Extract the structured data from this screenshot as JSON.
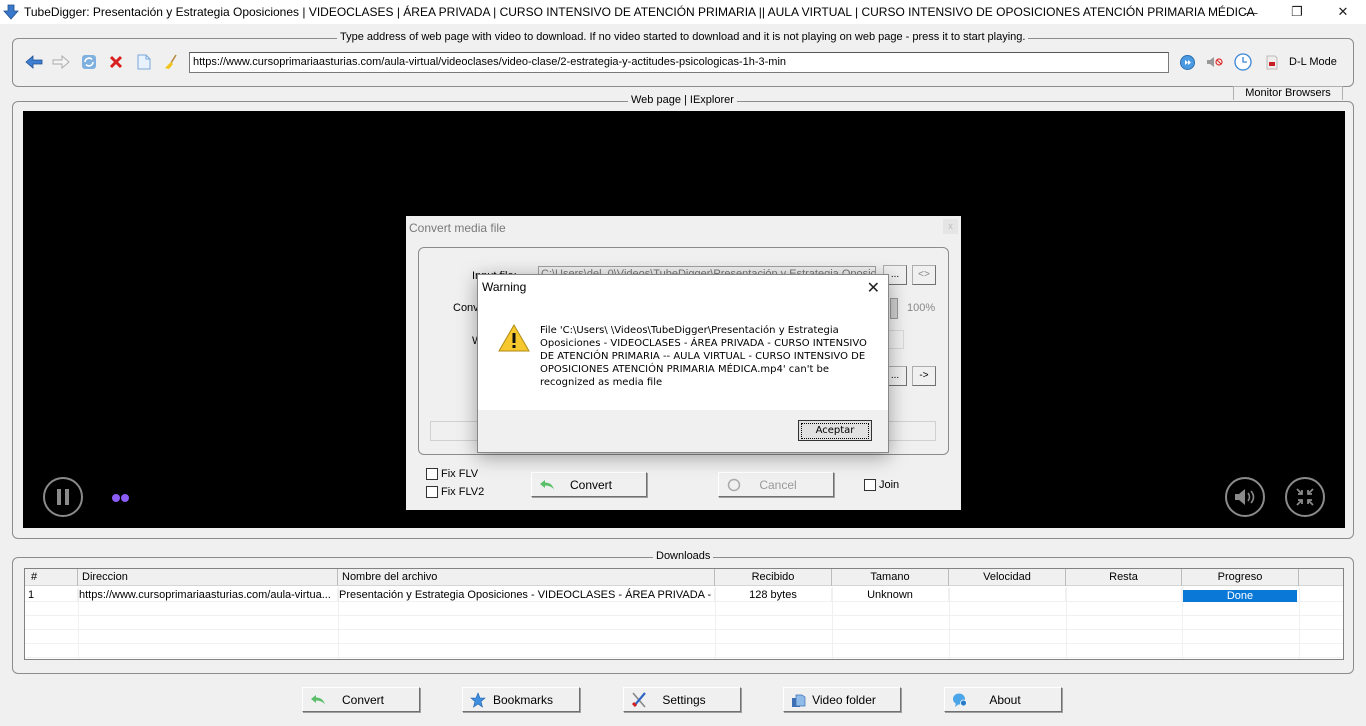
{
  "window": {
    "title": "TubeDigger: Presentación y Estrategia Oposiciones | VIDEOCLASES | ÁREA PRIVADA | CURSO INTENSIVO DE ATENCIÓN PRIMARIA || AULA VIRTUAL | CURSO INTENSIVO DE OPOSICIONES ATENCIÓN PRIMARIA MÉDICA",
    "minimize": "—",
    "maximize": "❐",
    "close": "✕"
  },
  "address_bar": {
    "legend": "Type address of web page with video to download. If no video started to download and it is not playing on web page - press it to start playing.",
    "url": "https://www.cursoprimariaasturias.com/aula-virtual/videoclases/video-clase/2-estrategia-y-actitudes-psicologicas-1h-3-min",
    "icons": [
      "back-arrow-icon",
      "forward-arrow-icon",
      "refresh-icon",
      "stop-icon",
      "new-page-icon",
      "clear-broom-icon"
    ],
    "right_icons": [
      "play-fast-icon",
      "mute-icon",
      "clock-icon",
      "record-icon"
    ],
    "dl_mode_label": "D-L Mode"
  },
  "webpage": {
    "legend": "Web page | IExplorer",
    "monitor_tab": "Monitor Browsers"
  },
  "player": {
    "pause_icon": "pause-icon",
    "volume_icon": "volume-icon",
    "exit_fullscreen_icon": "exit-fullscreen-icon",
    "loading_dots_color": "#8b5cf6"
  },
  "convert_dialog": {
    "title": "Convert media file",
    "input_label": "Input file:",
    "input_value": "C:\\Users\\del_0\\Videos\\TubeDigger\\Presentación y Estrategia Oposici",
    "convert_label": "Conv",
    "progress_label": "100%",
    "w_label": "W",
    "browse_label": "...",
    "swap_label": "<>",
    "go_label": "->",
    "fix_flv_label": "Fix FLV",
    "fix_flv2_label": "Fix FLV2",
    "convert_button": "Convert",
    "cancel_button": "Cancel",
    "join_label": "Join"
  },
  "warning_dialog": {
    "title": "Warning",
    "close": "✕",
    "message": "File 'C:\\Users\\          \\Videos\\TubeDigger\\Presentación y Estrategia Oposiciones - VIDEOCLASES - ÁREA PRIVADA - CURSO INTENSIVO DE ATENCIÓN PRIMARIA -- AULA VIRTUAL - CURSO INTENSIVO DE OPOSICIONES ATENCIÓN PRIMARIA MÉDICA.mp4' can't be recognized as media file",
    "ok_button": "Aceptar"
  },
  "downloads": {
    "legend": "Downloads",
    "columns": [
      "#",
      "Direccion",
      "Nombre del archivo",
      "Recibido",
      "Tamano",
      "Velocidad",
      "Resta",
      "Progreso"
    ],
    "rows": [
      {
        "num": "1",
        "url": "https://www.cursoprimariaasturias.com/aula-virtua...",
        "filename": "Presentación y Estrategia Oposiciones - VIDEOCLASES - ÁREA PRIVADA - C...",
        "received": "128 bytes",
        "size": "Unknown",
        "speed": "",
        "remaining": "",
        "progress": "Done",
        "progress_percent": 100
      }
    ]
  },
  "bottom_buttons": [
    {
      "label": "Convert",
      "icon": "convert-arrow-icon"
    },
    {
      "label": "Bookmarks",
      "icon": "star-icon"
    },
    {
      "label": "Settings",
      "icon": "tools-icon"
    },
    {
      "label": "Video folder",
      "icon": "folder-icon"
    },
    {
      "label": "About",
      "icon": "info-bubble-icon"
    }
  ],
  "colors": {
    "accent": "#0a78d7",
    "player_bg": "#000000",
    "window_bg": "#f0f0f0"
  }
}
